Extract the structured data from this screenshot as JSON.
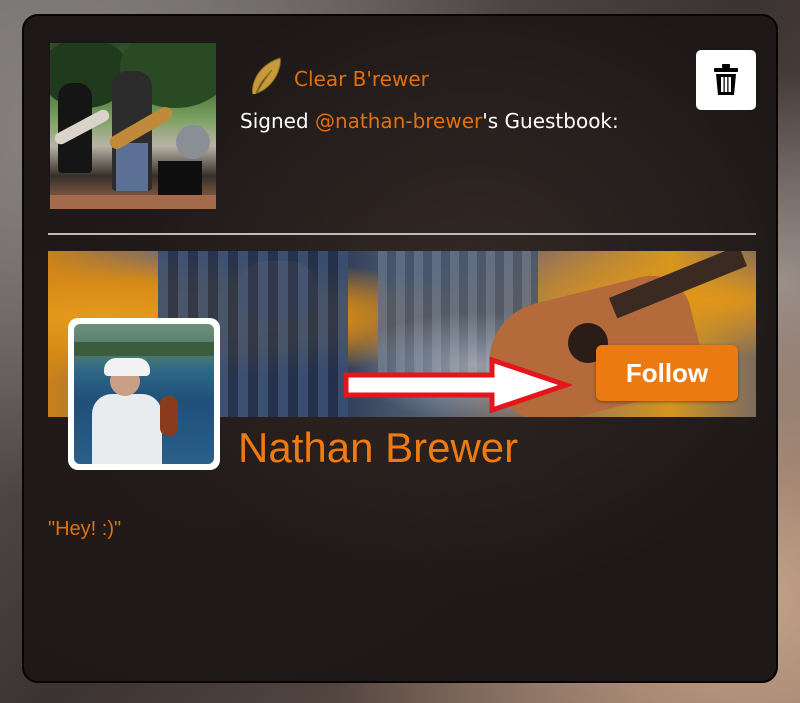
{
  "entry": {
    "author_name": "Clear B'rewer",
    "signed_prefix": "Signed ",
    "signed_target": "@nathan-brewer",
    "signed_suffix": "'s Guestbook:",
    "message": "\"Hey! :)\""
  },
  "profile": {
    "name": "Nathan Brewer",
    "follow_label": "Follow"
  },
  "icons": {
    "quill": "quill-icon",
    "trash": "trash-icon",
    "arrow": "red-arrow-annotation"
  },
  "colors": {
    "accent": "#ec7a12",
    "text": "#ffffff",
    "card_bg": "#1d1817",
    "annotation": "#e4161b"
  }
}
